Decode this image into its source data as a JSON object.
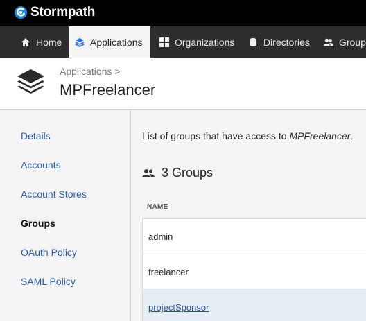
{
  "brand": {
    "name": "Stormpath",
    "logo_color": "#1e88e5"
  },
  "nav": {
    "items": [
      {
        "label": "Home",
        "icon": "home-icon"
      },
      {
        "label": "Applications",
        "icon": "layers-icon",
        "active": true
      },
      {
        "label": "Organizations",
        "icon": "grid-icon"
      },
      {
        "label": "Directories",
        "icon": "database-icon"
      },
      {
        "label": "Groups",
        "icon": "users-icon"
      }
    ]
  },
  "header": {
    "breadcrumb": "Applications",
    "breadcrumb_sep": ">",
    "title": "MPFreelancer",
    "icon": "layers-icon"
  },
  "sidebar": {
    "items": [
      {
        "label": "Details"
      },
      {
        "label": "Accounts"
      },
      {
        "label": "Account Stores"
      },
      {
        "label": "Groups",
        "active": true
      },
      {
        "label": "OAuth Policy"
      },
      {
        "label": "SAML Policy"
      }
    ]
  },
  "main": {
    "description_prefix": "List of groups that have access to ",
    "description_app": "MPFreelancer",
    "description_suffix": ".",
    "groups_count": "3 Groups",
    "column_name": "NAME",
    "rows": [
      {
        "name": "admin"
      },
      {
        "name": "freelancer"
      },
      {
        "name": "projectSponsor",
        "highlighted": true
      }
    ]
  },
  "colors": {
    "link": "#2a5da8",
    "nav_bg": "#2d2d2d",
    "topbar_bg": "#000000",
    "row_highlight": "#e6eef3"
  }
}
